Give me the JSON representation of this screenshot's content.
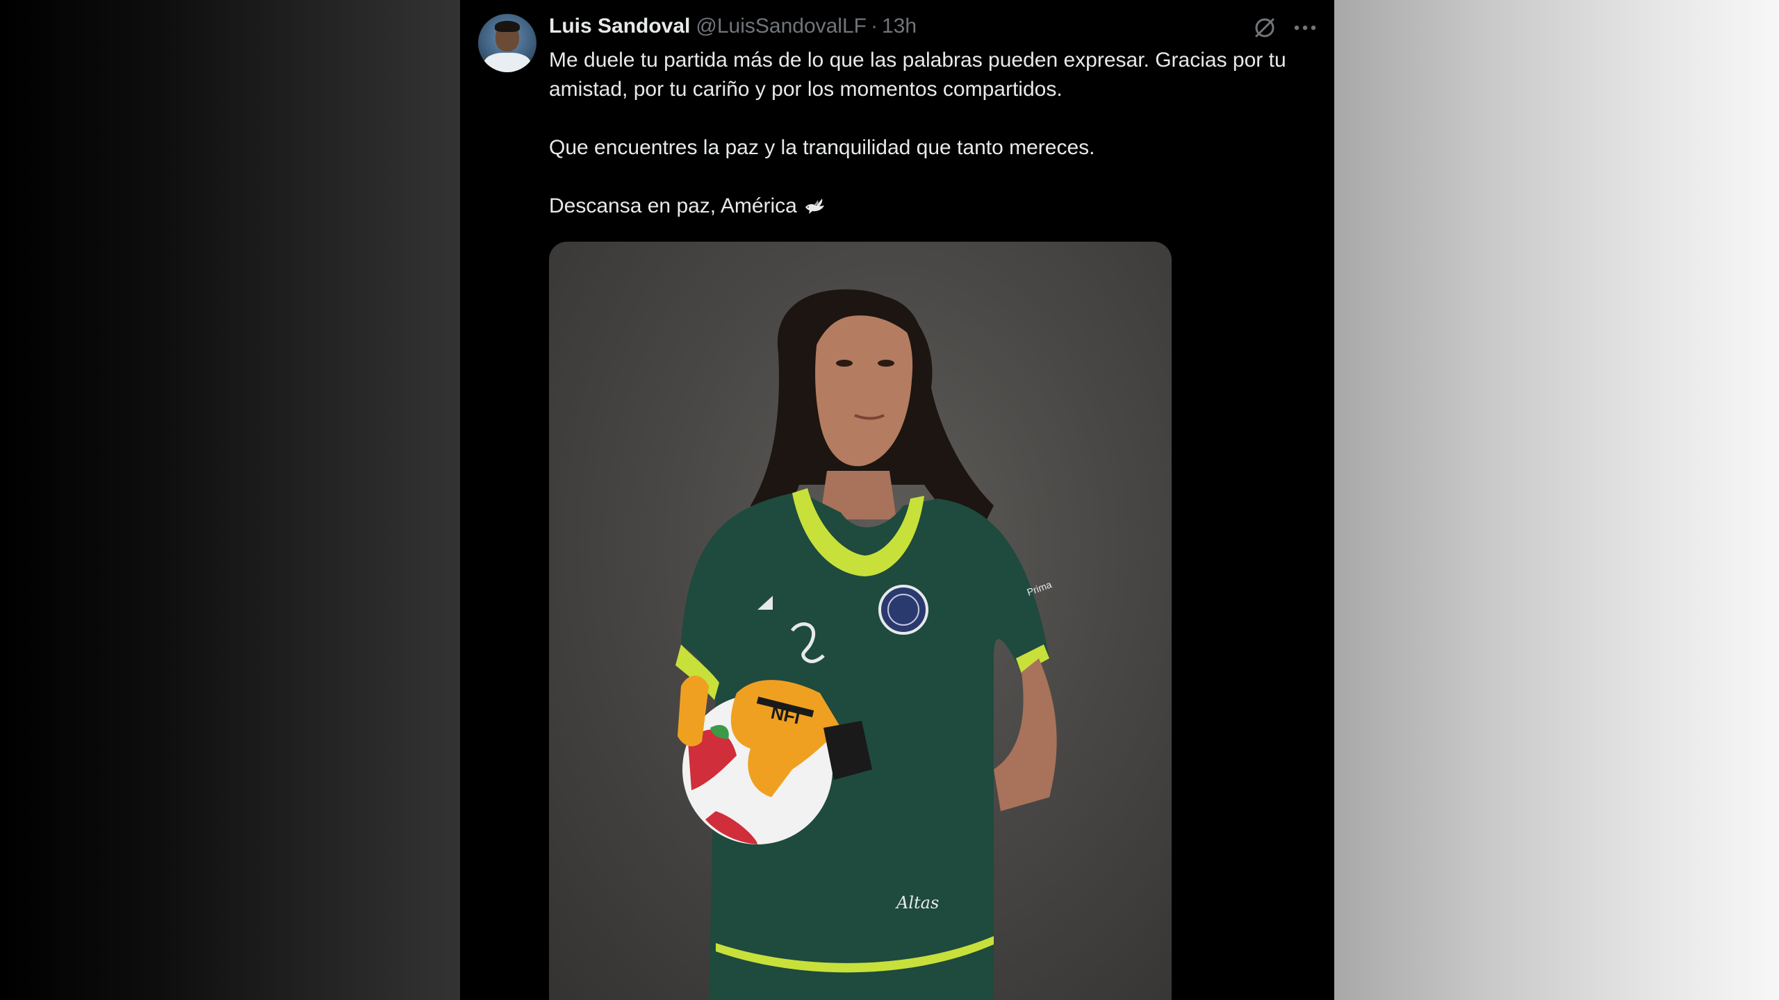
{
  "tweet": {
    "author": {
      "display_name": "Luis Sandoval",
      "handle": "@LuisSandovalLF"
    },
    "separator": "·",
    "time": "13h",
    "paragraphs": [
      "Me duele tu partida más de lo que las palabras pueden expresar. Gracias por tu amistad, por tu cariño y por los momentos compartidos.",
      "Que encuentres la paz y la tranquilidad que tanto mereces.",
      "Descansa en paz, América"
    ],
    "emoji_icon": "dove-icon",
    "actions": {
      "grok_icon": "grok-icon",
      "more_icon": "more-icon"
    },
    "media": {
      "jersey_brand_text": "Prima",
      "gloves_text": "NFI",
      "jersey_bottom_text": "Altas"
    }
  },
  "colors": {
    "background": "#000000",
    "text_primary": "#e7e9ea",
    "text_secondary": "#71767b",
    "jersey_green": "#1f4a3e",
    "jersey_collar": "#c8e03a",
    "glove_orange": "#f0a020"
  }
}
